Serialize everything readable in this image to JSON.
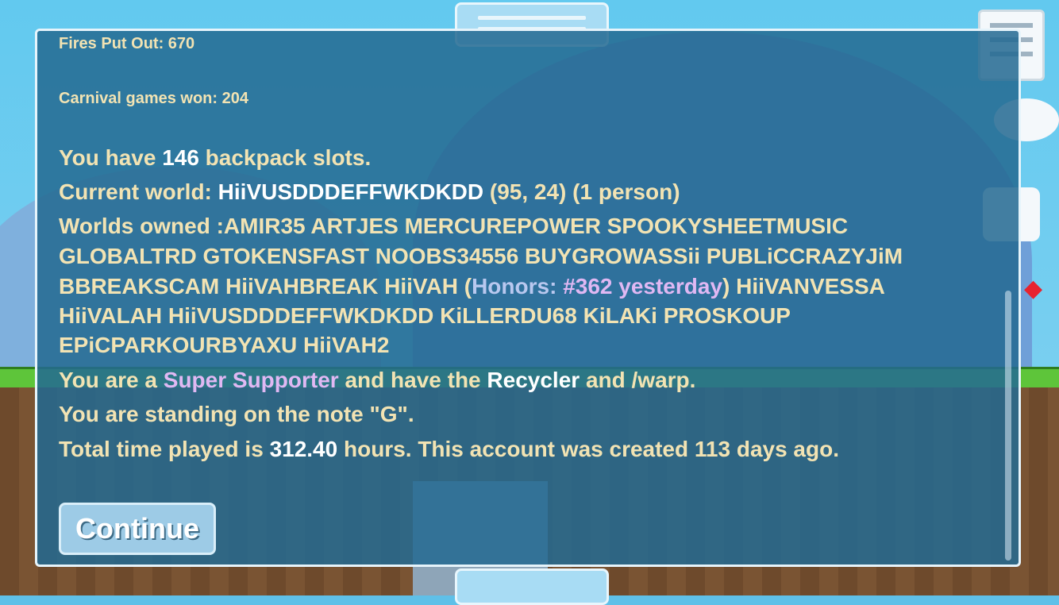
{
  "stats": {
    "fires_put_out": "Fires Put Out: 670",
    "carnival_games": "Carnival games won: 204"
  },
  "backpack": {
    "prefix": "You have ",
    "count": "146",
    "suffix": " backpack slots."
  },
  "current_world": {
    "prefix": "Current world: ",
    "name": "HiiVUSDDDEFFWKDKDD",
    "coords": " (95, 24) (1 person)"
  },
  "worlds_owned": {
    "line1": "Worlds owned :AMIR35 ARTJES MERCUREPOWER SPOOKYSHEETMUSIC",
    "line2": "GLOBALTRD GTOKENSFAST NOOBS34556 BUYGROWASSii PUBLiCCRAZYJiM",
    "line3_pre": "BBREAKSCAM HiiVAHBREAK HiiVAH (",
    "honors_label": "Honors: ",
    "honors_value": "#362 yesterday",
    "line3_post": ") HiiVANVESSA",
    "line4": "HiiVALAH HiiVUSDDDEFFWKDKDD KiLLERDU68 KiLAKi PROSKOUP",
    "line5": "EPiCPARKOURBYAXU HiiVAH2"
  },
  "supporter": {
    "prefix": "You are a ",
    "rank": "Super Supporter",
    "mid": " and have the ",
    "item": "Recycler",
    "suffix": " and /warp."
  },
  "note_line": "You are standing on the note \"G\".",
  "time_played": {
    "prefix": "Total time played is ",
    "hours": "312.40",
    "suffix": " hours.  This account was created 113 days ago."
  },
  "continue_label": "Continue",
  "colors": {
    "text": "#f2e3b3",
    "highlight": "#ffffff",
    "supporter": "#e0b8f3",
    "honors": "#b9c8ef",
    "panel": "#246a92"
  }
}
